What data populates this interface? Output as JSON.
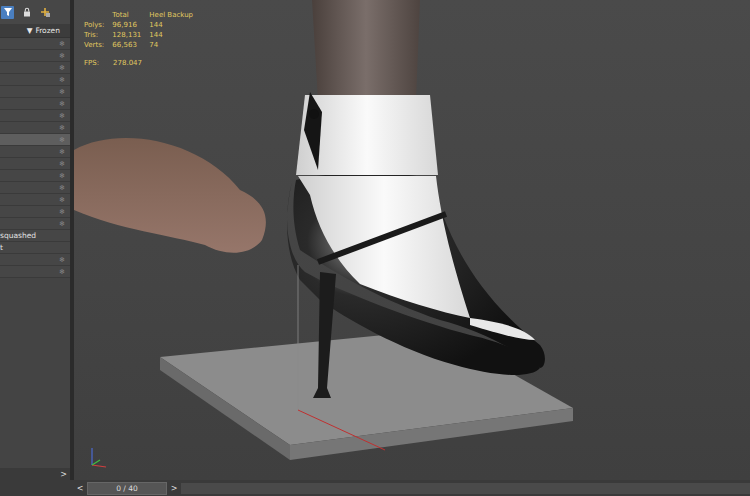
{
  "outliner": {
    "toolbar": [
      {
        "kind": "filter",
        "selected": true
      },
      {
        "kind": "lock",
        "selected": false
      },
      {
        "kind": "add",
        "selected": false
      }
    ],
    "column_header": {
      "arrow": "▼",
      "label": "Frozen"
    },
    "rows": [
      {
        "label": "",
        "icon": "❄",
        "selected": false
      },
      {
        "label": "",
        "icon": "❄",
        "selected": false
      },
      {
        "label": "",
        "icon": "❄",
        "selected": false
      },
      {
        "label": "",
        "icon": "❄",
        "selected": false
      },
      {
        "label": "",
        "icon": "❄",
        "selected": false
      },
      {
        "label": "",
        "icon": "❄",
        "selected": false
      },
      {
        "label": "",
        "icon": "❄",
        "selected": false
      },
      {
        "label": "",
        "icon": "❄",
        "selected": false
      },
      {
        "label": "",
        "icon": "❄",
        "selected": true
      },
      {
        "label": "",
        "icon": "❄",
        "selected": false
      },
      {
        "label": "",
        "icon": "❄",
        "selected": false
      },
      {
        "label": "",
        "icon": "❄",
        "selected": false
      },
      {
        "label": "",
        "icon": "❄",
        "selected": false
      },
      {
        "label": "",
        "icon": "❄",
        "selected": false
      },
      {
        "label": "",
        "icon": "❄",
        "selected": false
      },
      {
        "label": "",
        "icon": "❄",
        "selected": false
      },
      {
        "label": "squashed",
        "icon": "",
        "selected": false
      },
      {
        "label": "t",
        "icon": "",
        "selected": false
      },
      {
        "label": "",
        "icon": "❄",
        "selected": false
      },
      {
        "label": "",
        "icon": "❄",
        "selected": false
      }
    ],
    "scroll_next": ">"
  },
  "viewport": {
    "stats": {
      "columns": [
        "",
        "Total",
        "Heel Backup"
      ],
      "rows": [
        [
          "Polys:",
          "96,916",
          "144"
        ],
        [
          "Tris:",
          "128,131",
          "144"
        ],
        [
          "Verts:",
          "66,563",
          "74"
        ]
      ]
    },
    "fps": {
      "label": "FPS:",
      "value": "278.047"
    }
  },
  "timeline": {
    "prev": "<",
    "frame": "0 / 40",
    "next": ">",
    "level": 0
  }
}
